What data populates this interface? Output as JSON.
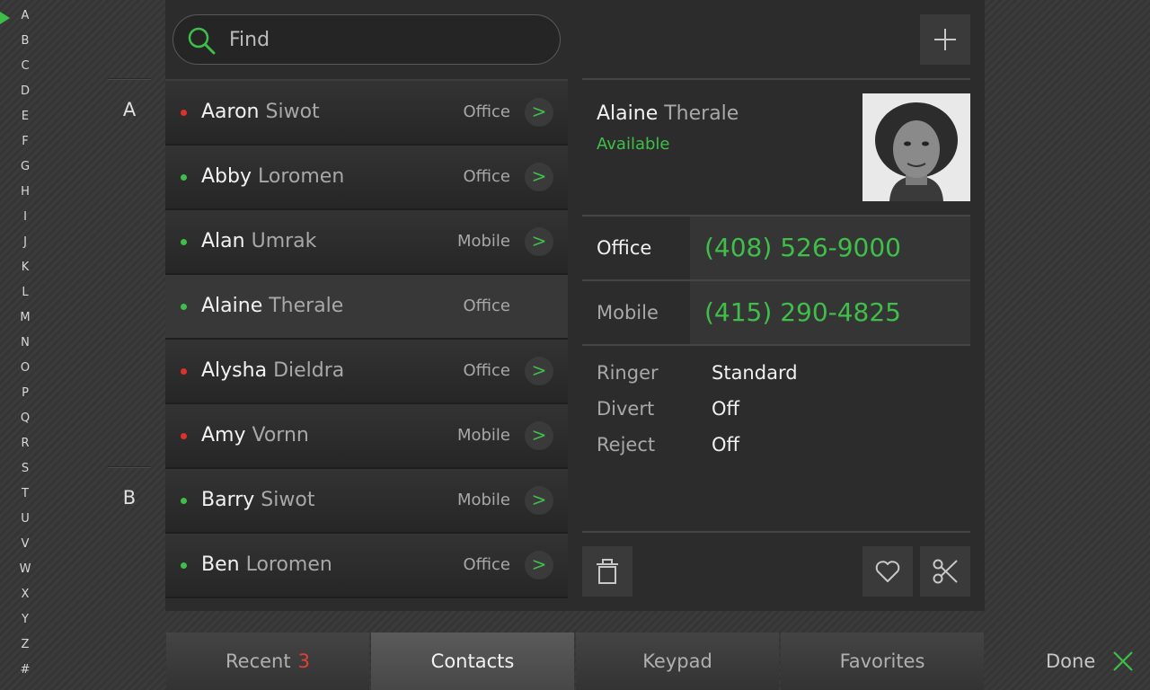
{
  "alphabet": [
    "A",
    "B",
    "C",
    "D",
    "E",
    "F",
    "G",
    "H",
    "I",
    "J",
    "K",
    "L",
    "M",
    "N",
    "O",
    "P",
    "Q",
    "R",
    "S",
    "T",
    "U",
    "V",
    "W",
    "X",
    "Y",
    "Z",
    "#"
  ],
  "sections": [
    "A",
    "B"
  ],
  "search": {
    "placeholder": "Find"
  },
  "contacts": [
    {
      "first": "Aaron",
      "last": "Siwot",
      "type": "Office",
      "status": "busy"
    },
    {
      "first": "Abby",
      "last": "Loromen",
      "type": "Office",
      "status": "available"
    },
    {
      "first": "Alan",
      "last": "Umrak",
      "type": "Mobile",
      "status": "available"
    },
    {
      "first": "Alaine",
      "last": "Therale",
      "type": "Office",
      "status": "available"
    },
    {
      "first": "Alysha",
      "last": "Dieldra",
      "type": "Office",
      "status": "busy"
    },
    {
      "first": "Amy",
      "last": "Vornn",
      "type": "Mobile",
      "status": "busy"
    },
    {
      "first": "Barry",
      "last": "Siwot",
      "type": "Mobile",
      "status": "available"
    },
    {
      "first": "Ben",
      "last": "Loromen",
      "type": "Office",
      "status": "available"
    }
  ],
  "detail": {
    "first": "Alaine",
    "last": "Therale",
    "status": "Available",
    "phones": [
      {
        "label": "Office",
        "number": "(408) 526-9000"
      },
      {
        "label": "Mobile",
        "number": "(415) 290-4825"
      }
    ],
    "settings": [
      {
        "label": "Ringer",
        "value": "Standard"
      },
      {
        "label": "Divert",
        "value": "Off"
      },
      {
        "label": "Reject",
        "value": "Off"
      }
    ]
  },
  "tabs": {
    "recent": "Recent",
    "recent_badge": "3",
    "contacts": "Contacts",
    "keypad": "Keypad",
    "favorites": "Favorites"
  },
  "done_label": "Done",
  "colors": {
    "accent": "#3fbf4a",
    "busy": "#e0302a",
    "badge": "#e0403a"
  }
}
